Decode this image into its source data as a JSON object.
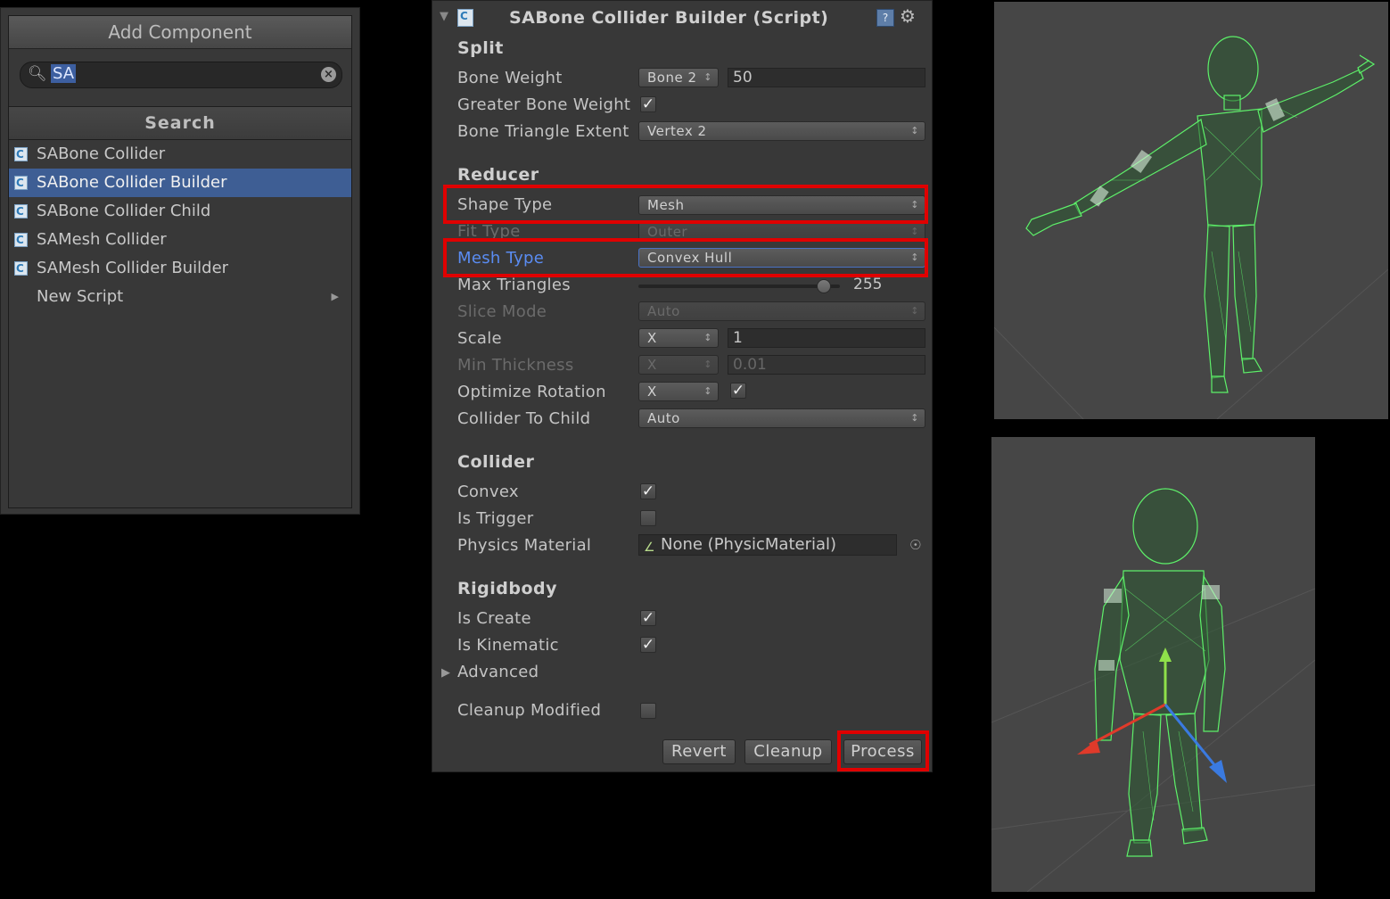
{
  "add_component": {
    "title": "Add Component",
    "search_value": "SA",
    "search_section": "Search",
    "items": [
      {
        "label": "SABone Collider"
      },
      {
        "label": "SABone Collider Builder",
        "selected": true
      },
      {
        "label": "SABone Collider Child"
      },
      {
        "label": "SAMesh Collider"
      },
      {
        "label": "SAMesh Collider Builder"
      },
      {
        "label": "New Script"
      }
    ]
  },
  "inspector": {
    "title": "SABone Collider Builder (Script)",
    "split": {
      "heading": "Split",
      "bone_weight": {
        "label": "Bone Weight",
        "dropdown": "Bone 2",
        "value": "50"
      },
      "greater_bone_weight": {
        "label": "Greater Bone Weight",
        "checked": true
      },
      "bone_triangle_extent": {
        "label": "Bone Triangle Extent",
        "value": "Vertex 2"
      }
    },
    "reducer": {
      "heading": "Reducer",
      "shape_type": {
        "label": "Shape Type",
        "value": "Mesh"
      },
      "fit_type": {
        "label": "Fit Type",
        "value": "Outer"
      },
      "mesh_type": {
        "label": "Mesh Type",
        "value": "Convex Hull"
      },
      "max_triangles": {
        "label": "Max Triangles",
        "value": "255",
        "fraction": 0.92
      },
      "slice_mode": {
        "label": "Slice Mode",
        "value": "Auto"
      },
      "scale": {
        "label": "Scale",
        "axis": "X",
        "value": "1"
      },
      "min_thickness": {
        "label": "Min Thickness",
        "axis": "X",
        "value": "0.01"
      },
      "optimize_rotation": {
        "label": "Optimize Rotation",
        "axis": "X",
        "checked": true
      },
      "collider_to_child": {
        "label": "Collider To Child",
        "value": "Auto"
      }
    },
    "collider": {
      "heading": "Collider",
      "convex": {
        "label": "Convex",
        "checked": true
      },
      "is_trigger": {
        "label": "Is Trigger",
        "checked": false
      },
      "physics_material": {
        "label": "Physics Material",
        "value": "None (PhysicMaterial)"
      }
    },
    "rigidbody": {
      "heading": "Rigidbody",
      "is_create": {
        "label": "Is Create",
        "checked": true
      },
      "is_kinematic": {
        "label": "Is Kinematic",
        "checked": true
      },
      "advanced": {
        "label": "Advanced"
      }
    },
    "cleanup_modified": {
      "label": "Cleanup Modified",
      "checked": false
    },
    "buttons": {
      "revert": "Revert",
      "cleanup": "Cleanup",
      "process": "Process"
    }
  },
  "colors": {
    "panel_bg": "#383838",
    "selection": "#3e5e94",
    "highlight": "#e00000",
    "wireframe": "#5ef06a",
    "scene_bg": "#464646"
  },
  "icons": [
    "search-icon",
    "clear-icon",
    "csharp-script-icon",
    "submenu-arrow-icon",
    "foldout-icon",
    "help-icon",
    "gear-icon",
    "checkmark-icon",
    "physic-material-icon",
    "object-picker-icon"
  ]
}
